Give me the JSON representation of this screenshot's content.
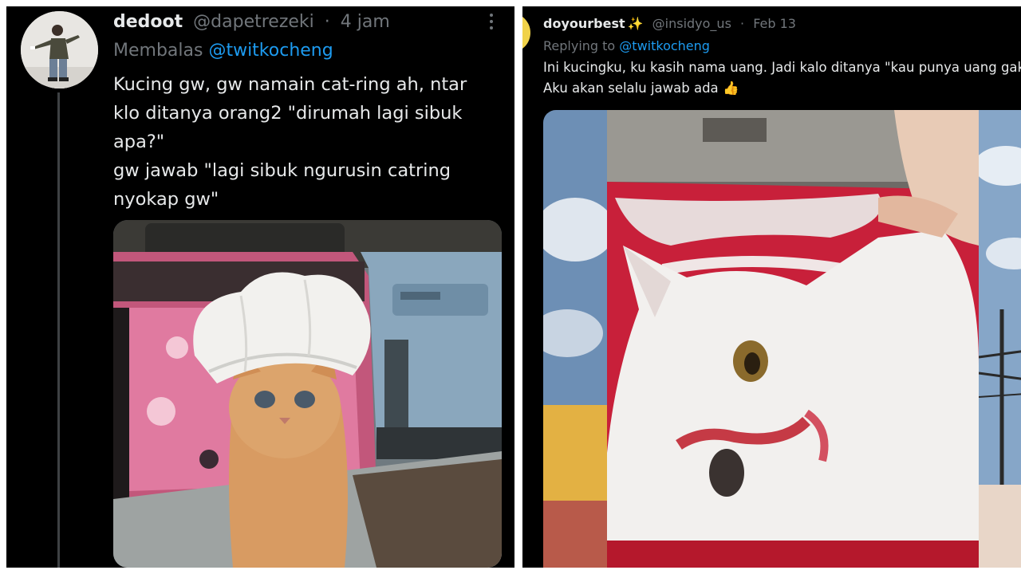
{
  "left_tweet": {
    "display_name": "dedoot",
    "handle": "@dapetrezeki",
    "separator": "·",
    "time": "4 jam",
    "reply_prefix": "Membalas",
    "reply_to": "@twitkocheng",
    "text_lines": [
      "Kucing gw, gw namain cat-ring ah, ntar",
      "klo ditanya orang2  \"dirumah lagi sibuk",
      "apa?\"",
      "gw jawab \"lagi sibuk ngurusin catring",
      "nyokap gw\""
    ],
    "media_icon": "kitten-chef-hat-photo",
    "avatar_icon": "person-avatar"
  },
  "right_tweet": {
    "display_name": "doyourbest",
    "sparkle": "✨",
    "handle": "@insidyo_us",
    "separator": "·",
    "date": "Feb 13",
    "reply_prefix": "Replying to",
    "reply_to": "@twitkocheng",
    "text_lines": [
      "Ini kucingku, ku kasih nama uang. Jadi kalo ditanya \"kau punya uang gak",
      "Aku akan selalu jawab ada"
    ],
    "text_emoji": "👍",
    "media_icon": "white-cat-collage-photo"
  },
  "colors": {
    "background": "#000000",
    "text": "#e7e9ea",
    "muted": "#71767b",
    "accent": "#1d9bf0"
  }
}
